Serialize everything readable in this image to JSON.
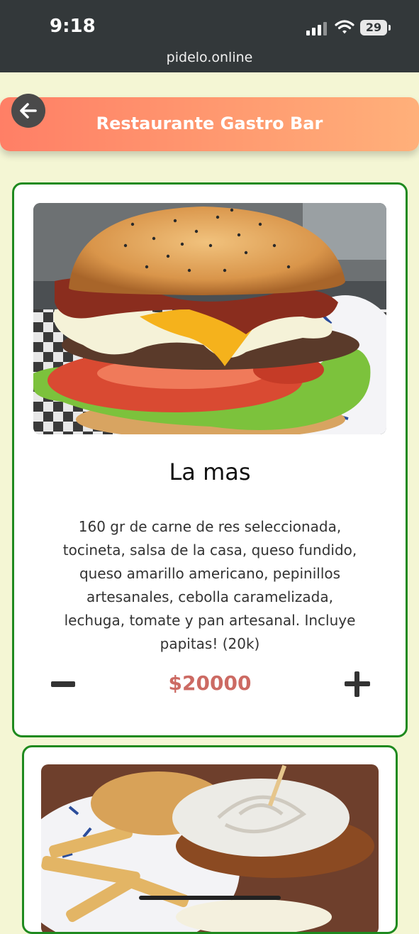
{
  "status_bar": {
    "time": "9:18",
    "battery": "29",
    "url": "pidelo.online"
  },
  "header": {
    "title": "Restaurante Gastro Bar",
    "back_icon": "arrow-left-icon"
  },
  "products": [
    {
      "name": "La mas",
      "description": "160 gr de carne de res seleccionada, tocineta, salsa de la casa, queso fundido, queso amarillo americano, pepinillos artesanales, cebolla caramelizada, lechuga, tomate y pan artesanal. Incluye papitas! (20k)",
      "price": "$20000",
      "decrease_icon": "minus-icon",
      "increase_icon": "plus-icon"
    }
  ],
  "colors": {
    "background": "#f4f6d4",
    "header_gradient_start": "#ff7f66",
    "header_gradient_end": "#ffb07a",
    "card_border": "#1f8a1f",
    "price": "#cc6a63"
  }
}
